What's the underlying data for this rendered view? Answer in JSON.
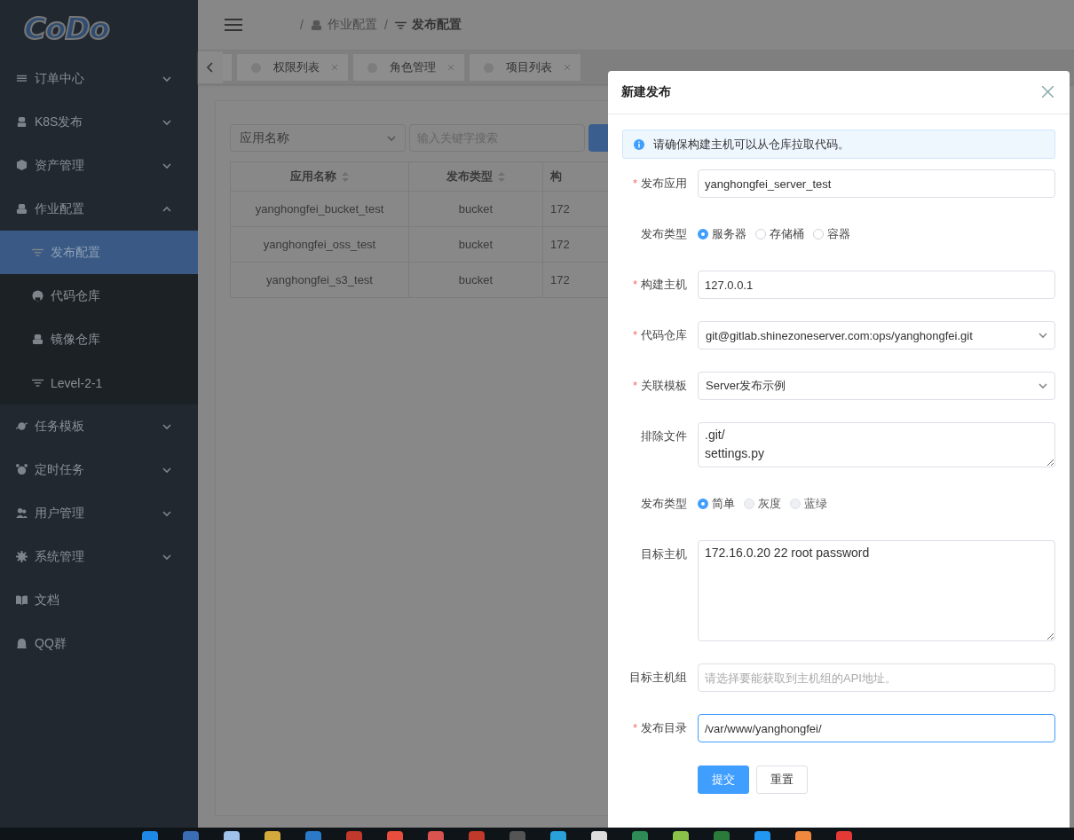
{
  "logo": {
    "text": "CoDo"
  },
  "sidebar": {
    "items": [
      {
        "label": "订单中心",
        "expanded": false,
        "selected": false
      },
      {
        "label": "K8S发布",
        "expanded": false,
        "selected": false
      },
      {
        "label": "资产管理",
        "expanded": false,
        "selected": false
      },
      {
        "label": "作业配置",
        "expanded": true,
        "selected": false,
        "children": [
          {
            "label": "发布配置",
            "selected": true
          },
          {
            "label": "代码仓库",
            "selected": false
          },
          {
            "label": "镜像仓库",
            "selected": false
          },
          {
            "label": "Level-2-1",
            "selected": false
          }
        ]
      },
      {
        "label": "任务模板",
        "expanded": false,
        "selected": false
      },
      {
        "label": "定时任务",
        "expanded": false,
        "selected": false
      },
      {
        "label": "用户管理",
        "expanded": false,
        "selected": false
      },
      {
        "label": "系统管理",
        "expanded": false,
        "selected": false
      },
      {
        "label": "文档",
        "selected": false
      },
      {
        "label": "QQ群",
        "selected": false
      }
    ]
  },
  "breadcrumb": [
    {
      "separator": "/",
      "label": "作业配置",
      "current": false
    },
    {
      "separator": "/",
      "label": "发布配置",
      "current": true
    }
  ],
  "tabs": [
    {
      "label": "权限列表",
      "selected": false
    },
    {
      "label": "角色管理",
      "selected": false
    },
    {
      "label": "项目列表",
      "selected": false
    }
  ],
  "toolbar": {
    "select": "应用名称",
    "search": {
      "placeholder": "输入关键字搜索"
    }
  },
  "table": {
    "columns": [
      {
        "label": "应用名称",
        "sortable": true
      },
      {
        "label": "发布类型",
        "sortable": true
      },
      {
        "label": "构",
        "sortable": false
      }
    ],
    "rows": [
      [
        "yanghongfei_bucket_test",
        "bucket",
        "172"
      ],
      [
        "yanghongfei_oss_test",
        "bucket",
        "172"
      ],
      [
        "yanghongfei_s3_test",
        "bucket",
        "172"
      ]
    ]
  },
  "dialog": {
    "title": "新建发布",
    "alert": "请确保构建主机可以从仓库拉取代码。",
    "fields": [
      {
        "kind": "input",
        "label": "发布应用",
        "required_mark": "*",
        "value": "yanghongfei_server_test",
        "focused": false
      },
      {
        "kind": "radio",
        "label": "发布类型",
        "options": [
          {
            "label": "服务器",
            "selected": true,
            "disabled": false
          },
          {
            "label": "存储桶",
            "selected": false,
            "disabled": false
          },
          {
            "label": "容器",
            "selected": false,
            "disabled": false
          }
        ]
      },
      {
        "kind": "input",
        "label": "构建主机",
        "required_mark": "*",
        "value": "127.0.0.1",
        "focused": false
      },
      {
        "kind": "select",
        "label": "代码仓库",
        "required_mark": "*",
        "value": "git@gitlab.shinezoneserver.com:ops/yanghongfei.git"
      },
      {
        "kind": "select",
        "label": "关联模板",
        "required_mark": "*",
        "value": "Server发布示例"
      },
      {
        "kind": "textarea",
        "label": "排除文件",
        "value": ".git/\nsettings.py"
      },
      {
        "kind": "radio",
        "label": "发布类型",
        "options": [
          {
            "label": "简单",
            "selected": true,
            "disabled": false
          },
          {
            "label": "灰度",
            "selected": false,
            "disabled": true
          },
          {
            "label": "蓝绿",
            "selected": false,
            "disabled": true
          }
        ]
      },
      {
        "kind": "large_textarea",
        "label": "目标主机",
        "value": "172.16.0.20 22 root password"
      },
      {
        "kind": "input",
        "label": "目标主机组",
        "placeholder": "请选择要能获取到主机组的API地址。",
        "focused": false
      },
      {
        "kind": "input",
        "label": "发布目录",
        "required_mark": "*",
        "value": "/var/www/yanghongfei/",
        "focused": true
      }
    ],
    "buttons": [
      {
        "label": "提交",
        "kind": "primary"
      },
      {
        "label": "重置",
        "kind": "default"
      }
    ]
  }
}
